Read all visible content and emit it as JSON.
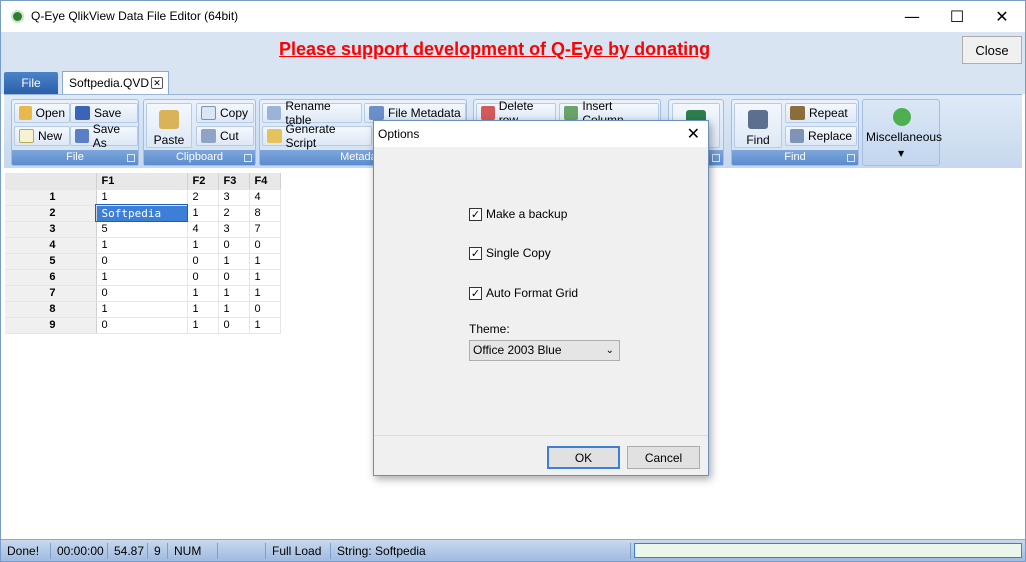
{
  "window": {
    "title": "Q-Eye QlikView Data File Editor (64bit)",
    "minimize_glyph": "—",
    "maximize_glyph": "☐",
    "close_glyph": "✕"
  },
  "banner": {
    "text": "Please support development of Q-Eye by  donating",
    "close_label": "Close",
    "color": "#ff0000"
  },
  "tabs": {
    "file_label": "File",
    "document_label": "Softpedia.QVD",
    "document_close": "✕"
  },
  "ribbon": {
    "file_group": {
      "label": "File",
      "open": "Open",
      "save": "Save",
      "new": "New",
      "save_as": "Save As"
    },
    "clipboard_group": {
      "label": "Clipboard",
      "paste": "Paste",
      "copy": "Copy",
      "cut": "Cut"
    },
    "metadata_group": {
      "label": "Metadata",
      "rename_table": "Rename table",
      "file_metadata": "File Metadata",
      "generate_script": "Generate Script"
    },
    "edit_group": {
      "delete_row": "Delete row",
      "insert_column": "Insert Column"
    },
    "find_group": {
      "label": "Find",
      "find": "Find",
      "repeat": "Repeat",
      "replace": "Replace"
    },
    "misc_group": {
      "label": "Miscellaneous"
    }
  },
  "grid": {
    "columns": [
      "F1",
      "F2",
      "F3",
      "F4"
    ],
    "rows": [
      {
        "num": "1",
        "cells": [
          "1",
          "2",
          "3",
          "4"
        ]
      },
      {
        "num": "2",
        "cells": [
          "Softpedia",
          "1",
          "2",
          "8"
        ]
      },
      {
        "num": "3",
        "cells": [
          "5",
          "4",
          "3",
          "7"
        ]
      },
      {
        "num": "4",
        "cells": [
          "1",
          "1",
          "0",
          "0"
        ]
      },
      {
        "num": "5",
        "cells": [
          "0",
          "0",
          "1",
          "1"
        ]
      },
      {
        "num": "6",
        "cells": [
          "1",
          "0",
          "0",
          "1"
        ]
      },
      {
        "num": "7",
        "cells": [
          "0",
          "1",
          "1",
          "1"
        ]
      },
      {
        "num": "8",
        "cells": [
          "1",
          "1",
          "1",
          "0"
        ]
      },
      {
        "num": "9",
        "cells": [
          "0",
          "1",
          "0",
          "1"
        ]
      }
    ]
  },
  "dialog": {
    "title": "Options",
    "close_glyph": "✕",
    "make_backup": {
      "label": "Make a backup",
      "checked": true
    },
    "single_copy": {
      "label": "Single Copy",
      "checked": true
    },
    "auto_format_grid": {
      "label": "Auto Format Grid",
      "checked": true
    },
    "theme_label": "Theme:",
    "theme_value": "Office 2003 Blue",
    "ok_label": "OK",
    "cancel_label": "Cancel"
  },
  "statusbar": {
    "status": "Done!",
    "time": "00:00:00",
    "value": "54.87",
    "count": "9",
    "num": "NUM",
    "load": "Full Load",
    "string": "String: Softpedia"
  }
}
